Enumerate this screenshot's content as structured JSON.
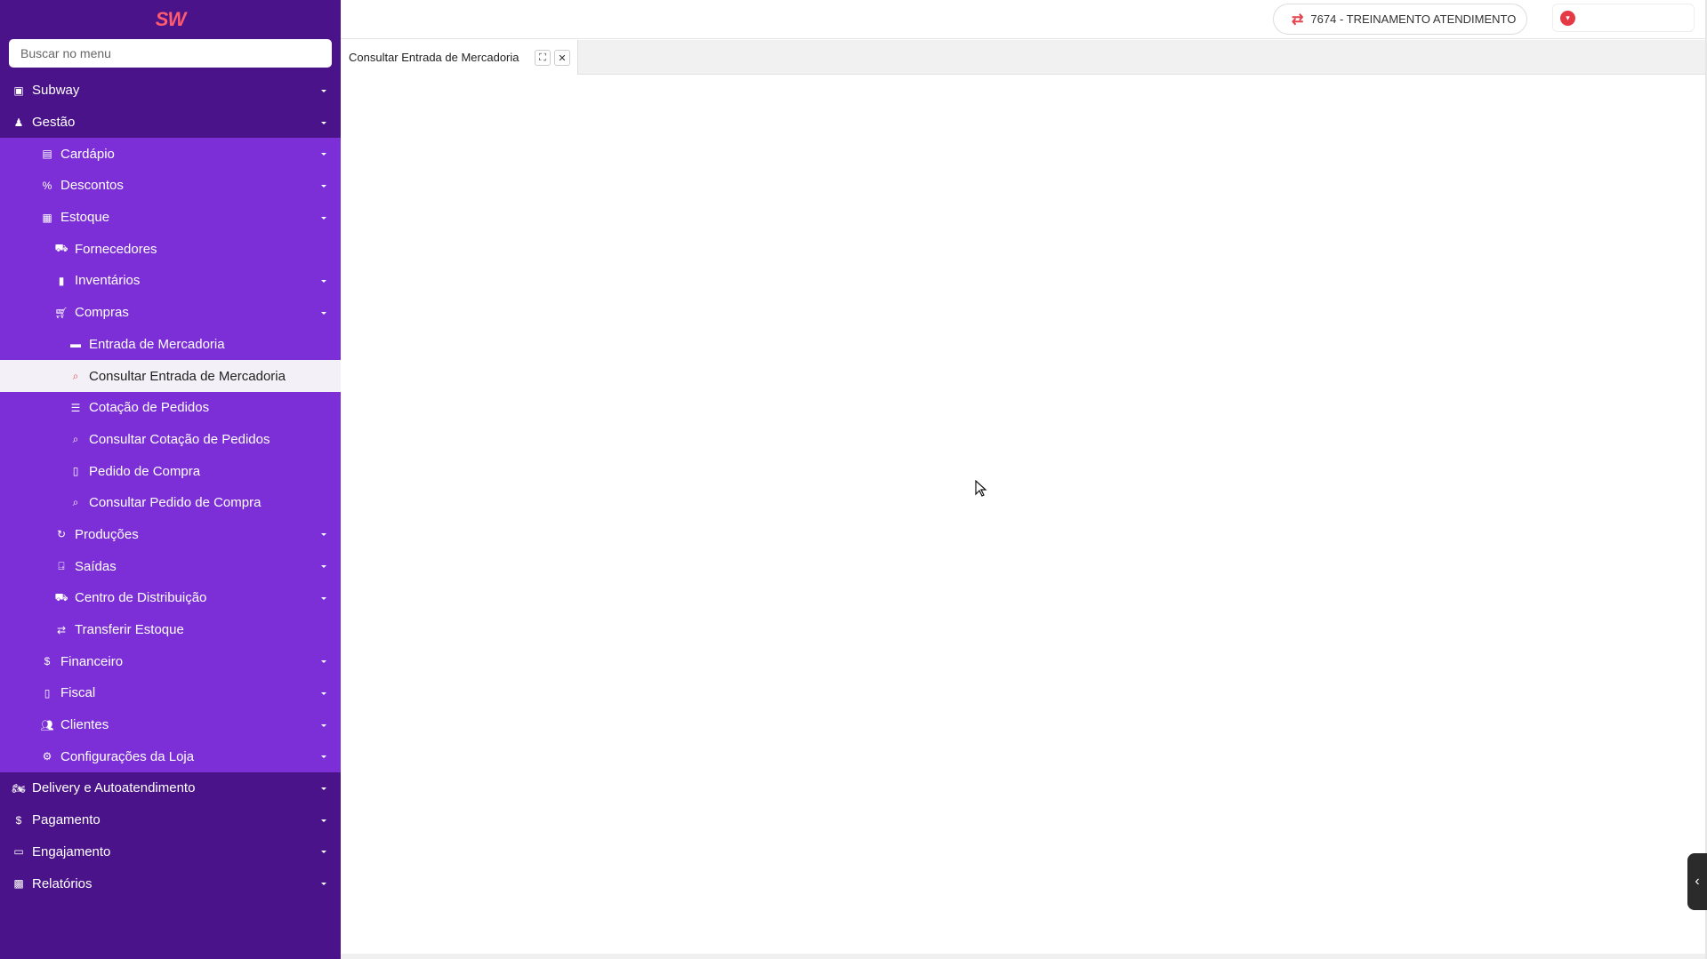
{
  "app": {
    "logo_text": "SW",
    "search_placeholder": "Buscar no menu"
  },
  "sidebar": {
    "items": [
      {
        "label": "Subway",
        "icon": "store-icon"
      },
      {
        "label": "Gestão",
        "icon": "management-icon"
      },
      {
        "label": "Cardápio",
        "icon": "book-icon"
      },
      {
        "label": "Descontos",
        "icon": "percent-icon"
      },
      {
        "label": "Estoque",
        "icon": "warehouse-icon"
      },
      {
        "label": "Fornecedores",
        "icon": "truck-icon"
      },
      {
        "label": "Inventários",
        "icon": "clipboard-icon"
      },
      {
        "label": "Compras",
        "icon": "cart-icon"
      },
      {
        "label": "Entrada de Mercadoria",
        "icon": "archive-icon"
      },
      {
        "label": "Consultar Entrada de Mercadoria",
        "icon": "search-icon"
      },
      {
        "label": "Cotação de Pedidos",
        "icon": "list-icon"
      },
      {
        "label": "Consultar Cotação de Pedidos",
        "icon": "search-icon"
      },
      {
        "label": "Pedido de Compra",
        "icon": "document-icon"
      },
      {
        "label": "Consultar Pedido de Compra",
        "icon": "search-icon"
      },
      {
        "label": "Produções",
        "icon": "refresh-icon"
      },
      {
        "label": "Saídas",
        "icon": "exit-icon"
      },
      {
        "label": "Centro de Distribuição",
        "icon": "truck-icon"
      },
      {
        "label": "Transferir Estoque",
        "icon": "transfer-icon"
      },
      {
        "label": "Financeiro",
        "icon": "dollar-icon"
      },
      {
        "label": "Fiscal",
        "icon": "document-icon"
      },
      {
        "label": "Clientes",
        "icon": "users-icon"
      },
      {
        "label": "Configurações da Loja",
        "icon": "gears-icon"
      },
      {
        "label": "Delivery e Autoatendimento",
        "icon": "motorcycle-icon"
      },
      {
        "label": "Pagamento",
        "icon": "dollar-icon"
      },
      {
        "label": "Engajamento",
        "icon": "card-icon"
      },
      {
        "label": "Relatórios",
        "icon": "chart-icon"
      }
    ]
  },
  "topbar": {
    "store_label": "7674 - TREINAMENTO ATENDIMENTO"
  },
  "tabs": [
    {
      "label": "Consultar Entrada de Mercadoria"
    }
  ],
  "colors": {
    "sidebar_dark": "#4a138a",
    "sidebar_sub": "#7c2fd6",
    "accent": "#e2454f"
  }
}
